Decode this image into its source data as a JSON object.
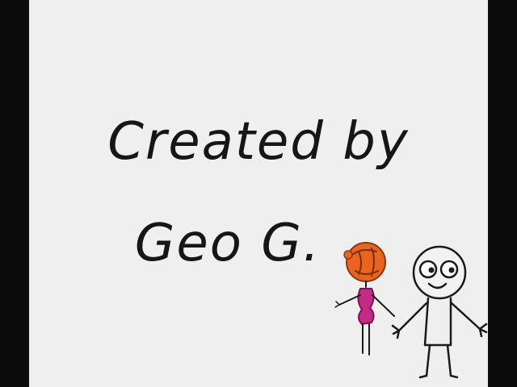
{
  "credits": {
    "line1": "Created by",
    "line2": "Geo G."
  },
  "illustration": {
    "figures": [
      {
        "icon": "girl-stick-figure-icon",
        "hair_color": "#e8641f",
        "dress_color": "#c42a86"
      },
      {
        "icon": "boy-stick-figure-icon",
        "outline_color": "#1a1a1a"
      }
    ]
  },
  "colors": {
    "background_bars": "#0b0b0b",
    "card": "#efefef",
    "text": "#161616"
  }
}
